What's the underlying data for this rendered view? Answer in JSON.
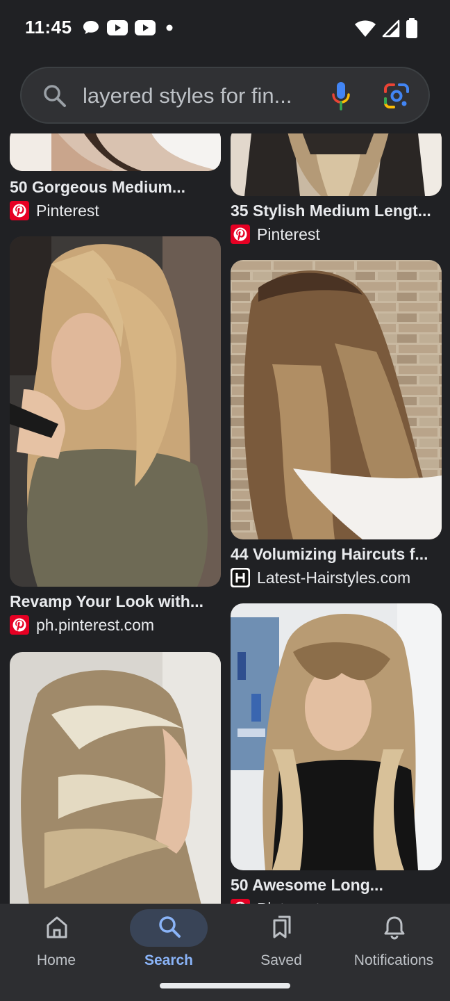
{
  "status_bar": {
    "time": "11:45",
    "left_icons": [
      "chat-bubble-icon",
      "youtube-icon",
      "youtube-icon",
      "dot-icon"
    ],
    "right_icons": [
      "wifi-icon",
      "signal-icon",
      "battery-icon"
    ]
  },
  "search": {
    "query": "layered styles for fin...",
    "icons": [
      "search-icon",
      "microphone-icon",
      "google-lens-icon"
    ]
  },
  "results": [
    {
      "title": "50 Gorgeous Medium...",
      "source": "Pinterest",
      "source_icon": "pinterest-icon"
    },
    {
      "title": "35 Stylish Medium Lengt...",
      "source": "Pinterest",
      "source_icon": "pinterest-icon"
    },
    {
      "title": "Revamp Your Look with...",
      "source": "ph.pinterest.com",
      "source_icon": "pinterest-icon"
    },
    {
      "title": "44 Volumizing Haircuts f...",
      "source": "Latest-Hairstyles.com",
      "source_icon": "latest-hairstyles-icon"
    },
    {
      "title": "",
      "source": "",
      "source_icon": ""
    },
    {
      "title": "50 Awesome Long...",
      "source": "Pinterest",
      "source_icon": "pinterest-icon"
    }
  ],
  "bottom_nav": {
    "items": [
      {
        "label": "Home",
        "icon": "home-icon",
        "active": false
      },
      {
        "label": "Search",
        "icon": "search-icon",
        "active": true
      },
      {
        "label": "Saved",
        "icon": "saved-icon",
        "active": false
      },
      {
        "label": "Notifications",
        "icon": "bell-icon",
        "active": false
      }
    ]
  },
  "colors": {
    "background": "#202124",
    "search_bar": "#303134",
    "nav_background": "#2d2e31",
    "active_accent": "#8ab4f8",
    "active_pill": "#394457",
    "pinterest_red": "#e60023"
  }
}
